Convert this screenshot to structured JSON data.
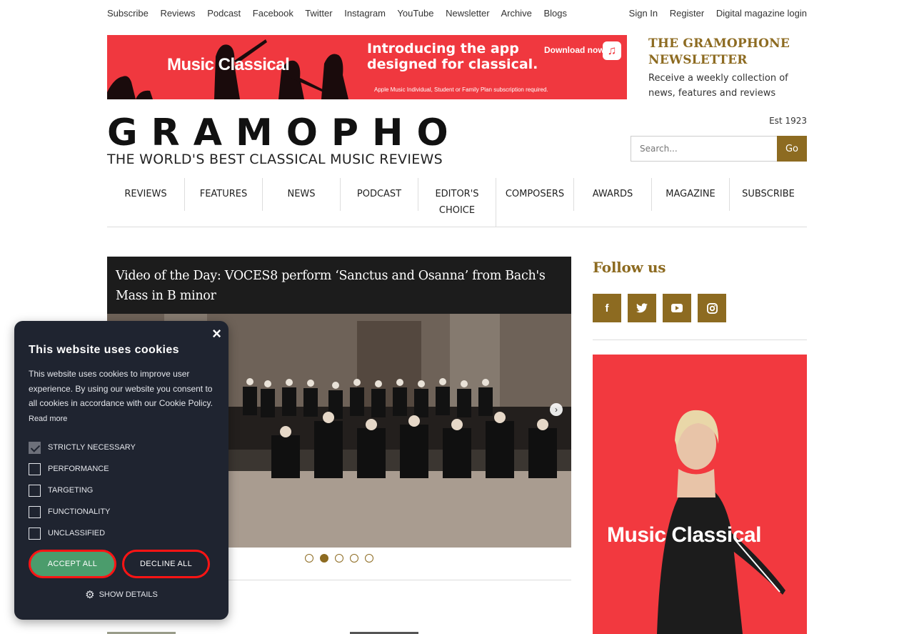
{
  "topnav": {
    "left": [
      "Subscribe",
      "Reviews",
      "Podcast",
      "Facebook",
      "Twitter",
      "Instagram",
      "YouTube",
      "Newsletter",
      "Archive",
      "Blogs"
    ],
    "right": [
      "Sign In",
      "Register",
      "Digital magazine login"
    ]
  },
  "banner": {
    "brand": "Music Classical",
    "headline": "Introducing the app designed for classical.",
    "cta": "Download now",
    "fine_print": "Apple Music Individual, Student or Family Plan subscription required."
  },
  "newsletter": {
    "title": "THE GRAMOPHONE NEWSLETTER",
    "text": "Receive a weekly collection of news, features and reviews"
  },
  "logo": {
    "word": "GRAMOPHONE",
    "tagline": "THE WORLD'S BEST CLASSICAL MUSIC REVIEWS"
  },
  "est": "Est 1923",
  "search": {
    "placeholder": "Search...",
    "button": "Go"
  },
  "mainnav": [
    "REVIEWS",
    "FEATURES",
    "NEWS",
    "PODCAST",
    "EDITOR'S CHOICE",
    "COMPOSERS",
    "AWARDS",
    "MAGAZINE",
    "SUBSCRIBE"
  ],
  "slider": {
    "caption": "Video of the Day: VOCES8 perform ‘Sanctus and Osanna’ from Bach's Mass in B minor",
    "slides": 5,
    "active_slide": 2
  },
  "follow": {
    "title": "Follow us",
    "icons": [
      "facebook-icon",
      "twitter-icon",
      "youtube-icon",
      "instagram-icon"
    ]
  },
  "sidead": {
    "brand": "Music Classical"
  },
  "cookie": {
    "title": "This website uses cookies",
    "description": "This website uses cookies to improve user experience. By using our website you consent to all cookies in accordance with our Cookie Policy.",
    "read_more": "Read more",
    "options": [
      "STRICTLY NECESSARY",
      "PERFORMANCE",
      "TARGETING",
      "FUNCTIONALITY",
      "UNCLASSIFIED"
    ],
    "accept": "ACCEPT ALL",
    "decline": "DECLINE ALL",
    "details": "SHOW DETAILS"
  },
  "colors": {
    "accent": "#8d6b21",
    "ad_red": "#f0383f",
    "cookie_bg": "#1f2430",
    "accept_green": "#4b9c6c"
  }
}
